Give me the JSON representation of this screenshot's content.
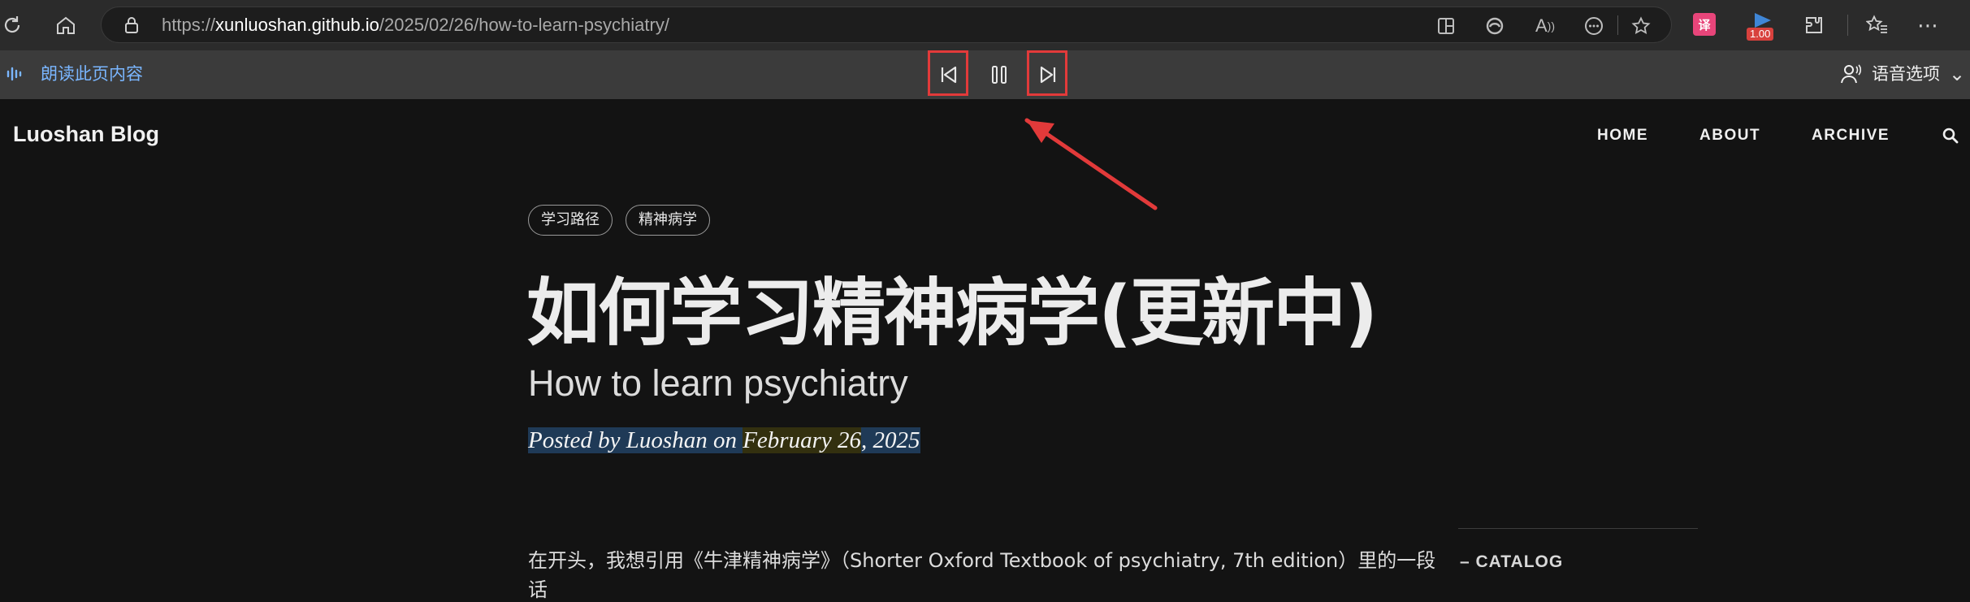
{
  "browser": {
    "url_prefix": "https://",
    "url_host": "xunluoshan.github.io",
    "url_path": "/2025/02/26/how-to-learn-psychiatry/",
    "zoom_badge": "1.00",
    "icons": [
      "refresh-icon",
      "home-icon",
      "lock-icon",
      "split-screen-icon",
      "edge-icon",
      "read-aloud-icon",
      "more-options-icon",
      "favorite-star-icon",
      "translate-extension-icon",
      "speed-extension-icon",
      "extensions-icon",
      "favorites-icon",
      "settings-more-icon"
    ]
  },
  "read_aloud": {
    "label": "朗读此页内容",
    "voice_options": "语音选项",
    "controls": [
      "previous-icon",
      "pause-icon",
      "next-icon"
    ],
    "highlight_color": "#e23a3a"
  },
  "site": {
    "brand": "Luoshan Blog",
    "nav": [
      "HOME",
      "ABOUT",
      "ARCHIVE"
    ]
  },
  "post": {
    "tags": [
      "学习路径",
      "精神病学"
    ],
    "title": "如何学习精神病学(更新中)",
    "subtitle": "How to learn psychiatry",
    "meta_part1": "Posted by Luoshan on ",
    "meta_part2": "February 26",
    "meta_part3": ", 2025",
    "paragraph": "在开头，我想引用《牛津精神病学》（Shorter Oxford Textbook of psychiatry, 7th edition）里的一段",
    "paragraph_cont": "话"
  },
  "sidebar": {
    "catalog": "CATALOG"
  }
}
